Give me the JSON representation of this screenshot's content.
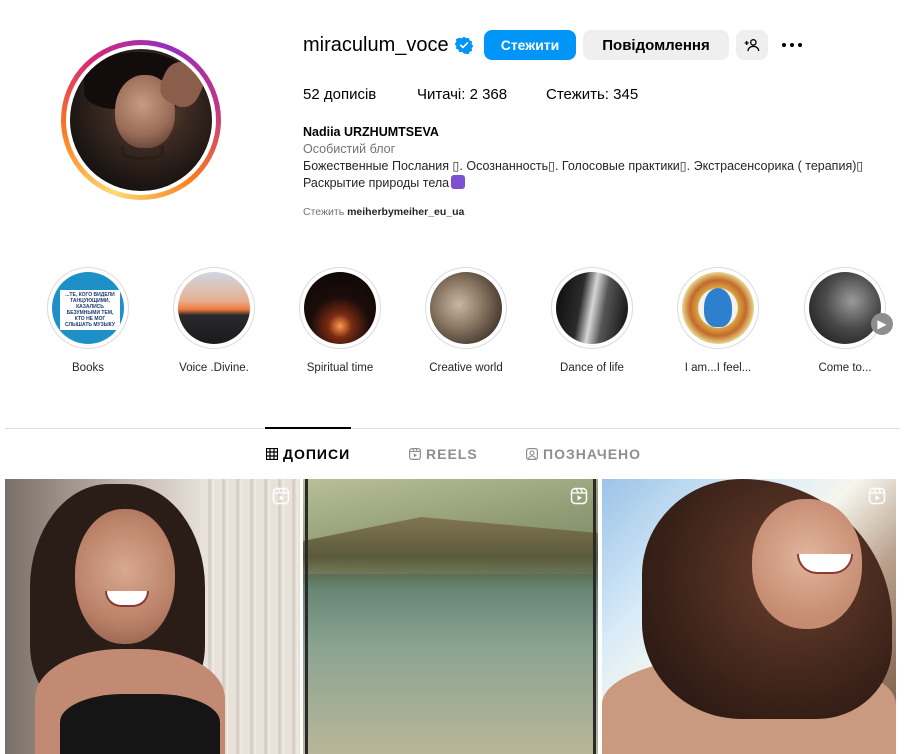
{
  "profile": {
    "username": "miraculum_voce",
    "follow_label": "Стежити",
    "message_label": "Повідомлення",
    "stats": {
      "posts": "52 дописів",
      "followers": "Читачі: 2 368",
      "following": "Стежить: 345"
    },
    "bio": {
      "name": "Nadiia URZHUMTSEVA",
      "category": "Особистий блог",
      "line1": "Божественные Послания ▯. Осознанность▯. Голосовые практики▯. Экстрасенсорика ( терапия)▯",
      "line2": "Раскрытие природы тела"
    },
    "followed_by_prefix": "Стежить",
    "followed_by_user": "meiherbymeiher_eu_ua"
  },
  "highlights": [
    {
      "label": "Books",
      "cover_text": "...ТЕ, КОГО ВИДЕЛИ ТАНЦУЮЩИМИ, КАЗАЛИСЬ БЕЗУМНЫМИ ТЕМ, КТО НЕ МОГ СЛЫШАТЬ МУЗЫКУ"
    },
    {
      "label": "Voice .Divine."
    },
    {
      "label": "Spiritual time"
    },
    {
      "label": "Creative world"
    },
    {
      "label": "Dance of life"
    },
    {
      "label": "I am...I feel..."
    },
    {
      "label": "Come to..."
    }
  ],
  "tabs": {
    "posts": "ДОПИСИ",
    "reels": "REELS",
    "tagged": "ПОЗНАЧЕНО"
  },
  "colors": {
    "primary_button": "#0095f6",
    "secondary_button": "#efefef",
    "verified_badge": "#0095f6",
    "muted_text": "#737373"
  },
  "icons": {
    "verified": "verified-badge-icon",
    "add_user": "add-user-icon",
    "more": "more-options-icon",
    "grid": "grid-icon",
    "reels": "reels-icon",
    "tagged": "tagged-icon",
    "reel_badge": "reel-icon",
    "next": "chevron-right-icon"
  }
}
